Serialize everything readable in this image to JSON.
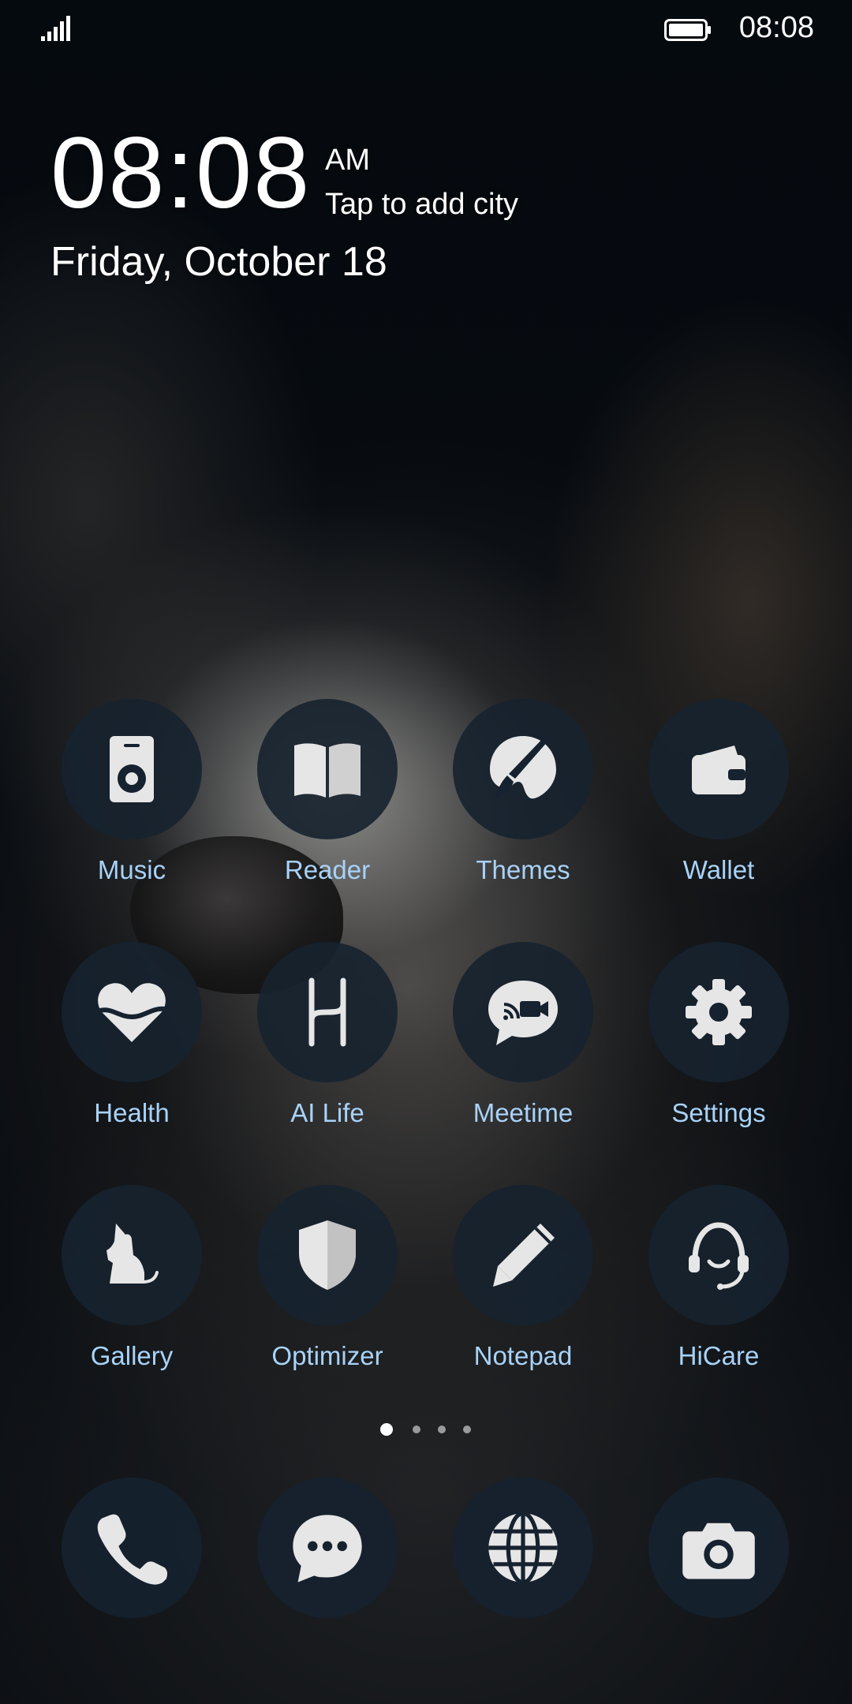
{
  "status_bar": {
    "time": "08:08",
    "signal_icon": "signal-icon",
    "battery_icon": "battery-icon"
  },
  "clock": {
    "time": "08:08",
    "ampm": "AM",
    "city_prompt": "Tap to add city",
    "date": "Friday, October 18"
  },
  "apps": [
    {
      "label": "Music",
      "icon": "music-speaker-icon"
    },
    {
      "label": "Reader",
      "icon": "book-icon"
    },
    {
      "label": "Themes",
      "icon": "paintbrush-icon"
    },
    {
      "label": "Wallet",
      "icon": "wallet-icon"
    },
    {
      "label": "Health",
      "icon": "heart-icon"
    },
    {
      "label": "AI Life",
      "icon": "ai-life-icon"
    },
    {
      "label": "Meetime",
      "icon": "video-chat-icon"
    },
    {
      "label": "Settings",
      "icon": "gear-icon"
    },
    {
      "label": "Gallery",
      "icon": "dog-icon"
    },
    {
      "label": "Optimizer",
      "icon": "shield-icon"
    },
    {
      "label": "Notepad",
      "icon": "pencil-icon"
    },
    {
      "label": "HiCare",
      "icon": "headset-icon"
    }
  ],
  "page_indicator": {
    "pages": 4,
    "current": 1
  },
  "dock": [
    {
      "icon": "phone-icon"
    },
    {
      "icon": "message-icon"
    },
    {
      "icon": "globe-icon"
    },
    {
      "icon": "camera-icon"
    }
  ],
  "colors": {
    "label": "#a8d2f8",
    "icon_bg": "#16222f",
    "icon_glyph": "#e6e6e6"
  }
}
